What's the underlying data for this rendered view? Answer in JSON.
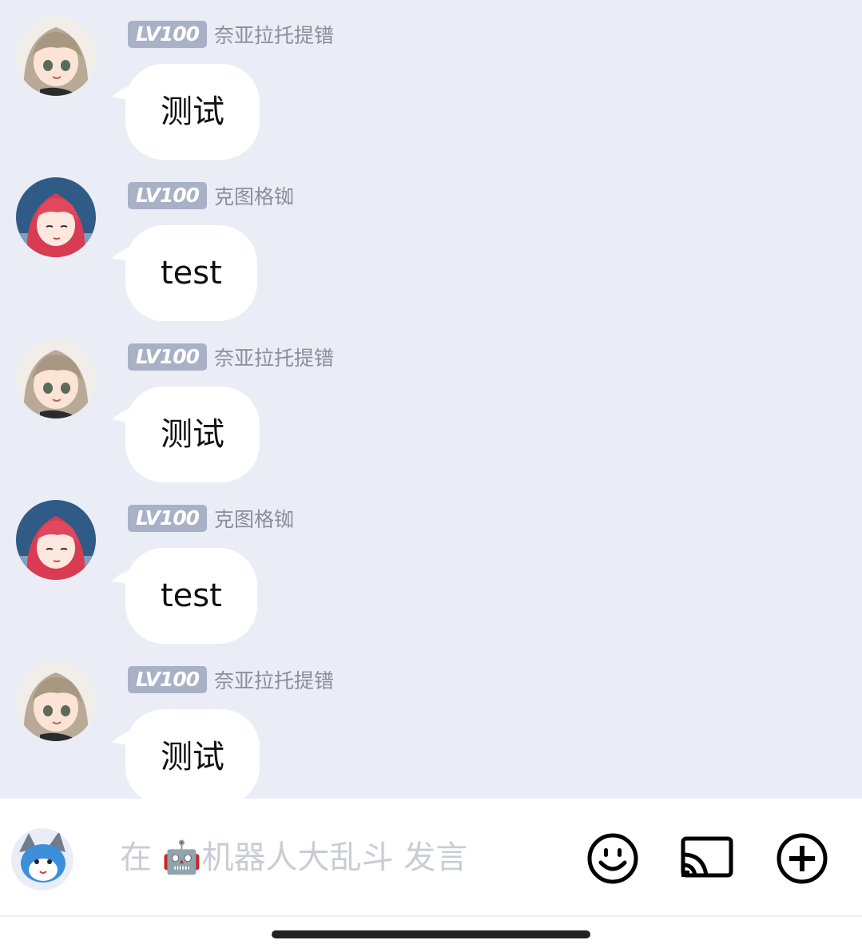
{
  "messages": [
    {
      "level": "LV100",
      "name": "奈亚拉托提镨",
      "text": "测试",
      "avatar": "girl-brown-hair"
    },
    {
      "level": "LV100",
      "name": "克图格铷",
      "text": "test",
      "avatar": "girl-red-hair"
    },
    {
      "level": "LV100",
      "name": "奈亚拉托提镨",
      "text": "测试",
      "avatar": "girl-brown-hair"
    },
    {
      "level": "LV100",
      "name": "克图格铷",
      "text": "test",
      "avatar": "girl-red-hair"
    },
    {
      "level": "LV100",
      "name": "奈亚拉托提镨",
      "text": "测试",
      "avatar": "girl-brown-hair"
    }
  ],
  "input": {
    "placeholder": "在 🤖机器人大乱斗 发言"
  },
  "icons": {
    "emoji": "smiley-icon",
    "cast": "cast-icon",
    "plus": "plus-circle-icon"
  },
  "colors": {
    "background": "#eaedf5",
    "badge": "#a9b1c6",
    "bubble": "#ffffff"
  }
}
